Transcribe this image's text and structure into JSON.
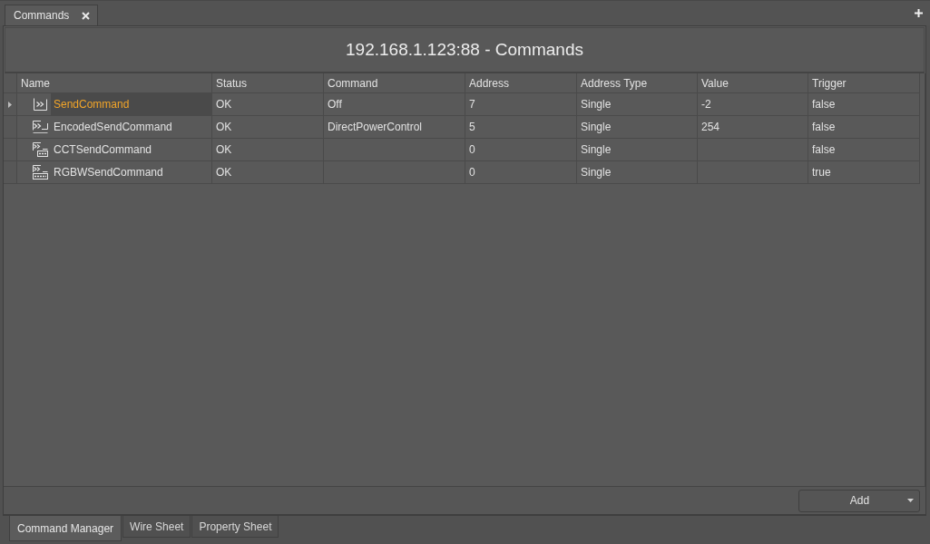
{
  "editor_tabs": [
    {
      "label": "Commands",
      "selected": true
    }
  ],
  "panel": {
    "title": "192.168.1.123:88 - Commands"
  },
  "table": {
    "columns": [
      "Name",
      "Status",
      "Command",
      "Address",
      "Address Type",
      "Value",
      "Trigger"
    ],
    "rows": [
      {
        "kind": "send",
        "selected": true,
        "name": "SendCommand",
        "status": "OK",
        "command": "Off",
        "address": "7",
        "address_type": "Single",
        "value": "-2",
        "trigger": "false"
      },
      {
        "kind": "encoded",
        "selected": false,
        "name": "EncodedSendCommand",
        "status": "OK",
        "command": "DirectPowerControl",
        "address": "5",
        "address_type": "Single",
        "value": "254",
        "trigger": "false"
      },
      {
        "kind": "cct",
        "selected": false,
        "name": "CCTSendCommand",
        "status": "OK",
        "address": "0",
        "address_type": "Single",
        "trigger": "false"
      },
      {
        "kind": "rgbw",
        "selected": false,
        "name": "RGBWSendCommand",
        "status": "OK",
        "address": "0",
        "address_type": "Single",
        "trigger": "true"
      }
    ]
  },
  "add_button": {
    "label": "Add"
  },
  "view_tabs": [
    {
      "label": "Command Manager",
      "selected": true
    },
    {
      "label": "Wire Sheet",
      "selected": false
    },
    {
      "label": "Property Sheet",
      "selected": false
    }
  ]
}
